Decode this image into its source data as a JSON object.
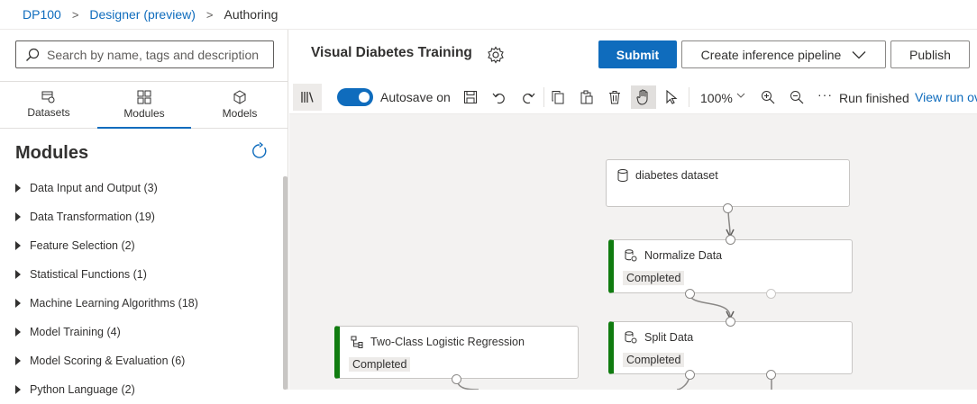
{
  "breadcrumb": {
    "items": [
      "DP100",
      "Designer (preview)"
    ],
    "current": "Authoring",
    "separator": ">"
  },
  "left_panel": {
    "search_placeholder": "Search by name, tags and description",
    "tabs": [
      {
        "label": "Datasets",
        "icon": "dataset-icon"
      },
      {
        "label": "Modules",
        "icon": "modules-icon",
        "active": true
      },
      {
        "label": "Models",
        "icon": "model-cube-icon"
      }
    ],
    "section_title": "Modules",
    "modules": [
      "Data Input and Output (3)",
      "Data Transformation (19)",
      "Feature Selection (2)",
      "Statistical Functions (1)",
      "Machine Learning Algorithms (18)",
      "Model Training (4)",
      "Model Scoring & Evaluation (6)",
      "Python Language (2)"
    ]
  },
  "header": {
    "pipeline_title": "Visual Diabetes Training",
    "submit_label": "Submit",
    "inference_label": "Create inference pipeline",
    "publish_label": "Publish"
  },
  "toolbar": {
    "autosave_label": "Autosave on",
    "autosave_on": true,
    "zoom": "100%",
    "more": "···",
    "run_status": "Run finished",
    "view_run_label": "View run ov"
  },
  "canvas": {
    "nodes": [
      {
        "title": "diabetes dataset",
        "status": "",
        "icon": "dataset-icon"
      },
      {
        "title": "Normalize Data",
        "status": "Completed",
        "icon": "module-icon"
      },
      {
        "title": "Split Data",
        "status": "Completed",
        "icon": "module-icon"
      },
      {
        "title": "Two-Class Logistic Regression",
        "status": "Completed",
        "icon": "algorithm-icon"
      }
    ]
  },
  "colors": {
    "accent": "#0f6cbd",
    "completed": "#107c10",
    "canvas_bg": "#f3f2f1"
  }
}
